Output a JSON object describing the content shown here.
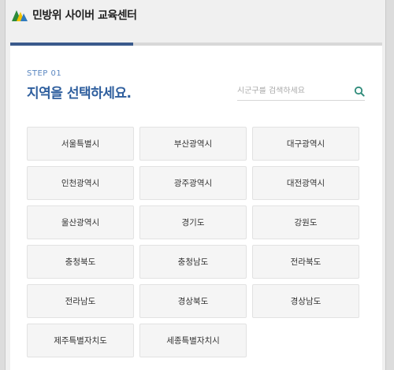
{
  "header": {
    "site_title": "민방위 사이버 교육센터",
    "logo_colors": [
      "#2c8a3b",
      "#f2c200",
      "#2f7bbf"
    ]
  },
  "progress": {
    "percent": 33
  },
  "step": {
    "label": "STEP 01",
    "title": "지역을 선택하세요."
  },
  "search": {
    "placeholder": "시군구를 검색하세요",
    "value": "",
    "icon": "search-icon",
    "icon_color": "#2e8b7a"
  },
  "regions": [
    "서울특별시",
    "부산광역시",
    "대구광역시",
    "인천광역시",
    "광주광역시",
    "대전광역시",
    "울산광역시",
    "경기도",
    "강원도",
    "충청북도",
    "충청남도",
    "전라북도",
    "전라남도",
    "경상북도",
    "경상남도",
    "제주특별자치도",
    "세종특별자치시"
  ],
  "colors": {
    "accent": "#2f5f9e",
    "step_label": "#5a86c0",
    "progress": "#3a5a8c"
  }
}
